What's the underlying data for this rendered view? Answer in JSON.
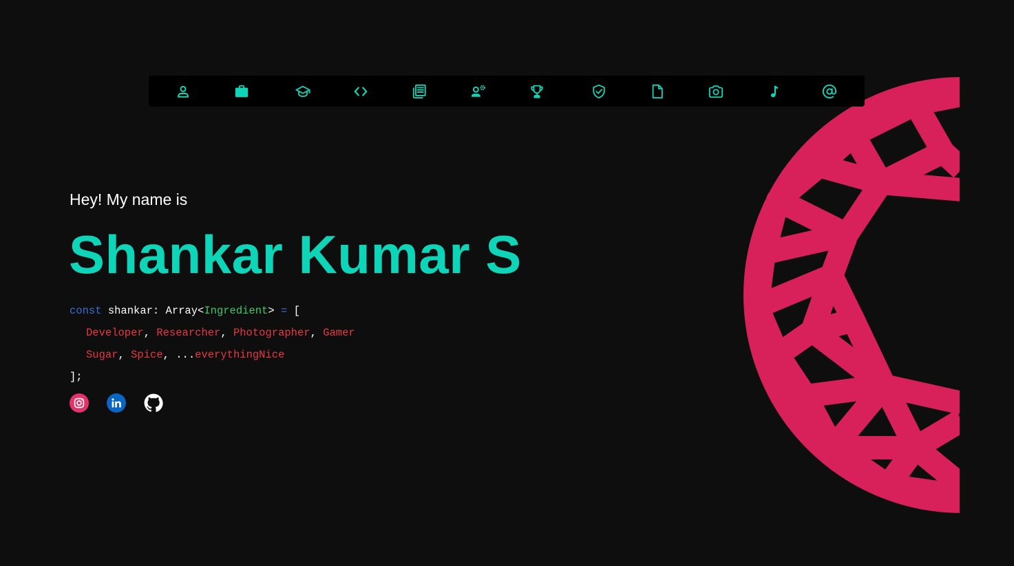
{
  "colors": {
    "accent": "#0fd5b8",
    "keyword": "#3b6fd6",
    "type": "#3ec86a",
    "string": "#e63945",
    "gem": "#d8215a",
    "background": "#0e0e0e"
  },
  "nav": {
    "items": [
      {
        "icon": "person-icon"
      },
      {
        "icon": "briefcase-icon"
      },
      {
        "icon": "graduation-cap-icon"
      },
      {
        "icon": "code-icon"
      },
      {
        "icon": "newspaper-icon"
      },
      {
        "icon": "user-gear-icon"
      },
      {
        "icon": "trophy-icon"
      },
      {
        "icon": "shield-check-icon"
      },
      {
        "icon": "file-icon"
      },
      {
        "icon": "camera-icon"
      },
      {
        "icon": "music-note-icon"
      },
      {
        "icon": "at-sign-icon"
      }
    ]
  },
  "hero": {
    "greeting": "Hey! My name is",
    "name": "Shankar Kumar S"
  },
  "code": {
    "kw_const": "const",
    "var_name": " shankar: Array<",
    "type_name": "Ingredient",
    "decl_end": "> ",
    "equals": "=",
    "open_bracket": " [",
    "line2": [
      "Developer",
      "Researcher",
      "Photographer",
      "Gamer"
    ],
    "line3": [
      "Sugar",
      "Spice"
    ],
    "spread": "...",
    "spread_name": "everythingNice",
    "comma": ", ",
    "closing": "];"
  },
  "socials": [
    {
      "icon": "instagram-icon"
    },
    {
      "icon": "linkedin-icon"
    },
    {
      "icon": "github-icon"
    }
  ]
}
